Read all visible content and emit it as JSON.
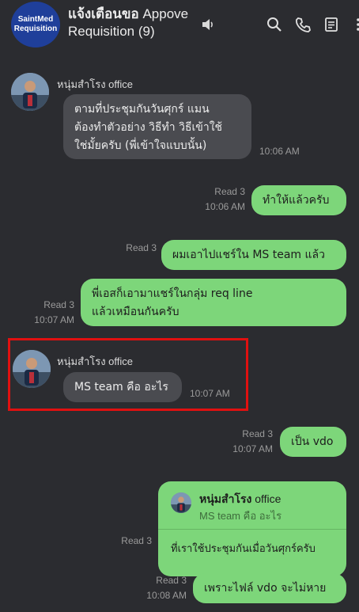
{
  "header": {
    "group_avatar_lines": [
      "SaintMed",
      "Requisition"
    ],
    "title_prefix": "แจ้งเตือนขอ",
    "title_rest": " Appove Requisition (9)",
    "icons": [
      "speaker-icon",
      "search-icon",
      "phone-icon",
      "notes-icon",
      "more-icon"
    ]
  },
  "messages": [
    {
      "sender": "หนุ่มสำโรง office",
      "lines": [
        "ตามที่ประชุมกันวันศุกร์ แมน",
        "ต้องทำตัวอย่าง วิธีทำ วิธีเข้าใช้",
        "ใช่มั้ยครับ (พี่เข้าใจแบบนั้น)"
      ],
      "time": "10:06 AM"
    },
    {
      "read": "Read 3",
      "time": "10:06 AM",
      "text": "ทำให้แล้วครับ"
    },
    {
      "read": "Read 3",
      "text": "ผมเอาไปแชร์ใน MS team แล้ว"
    },
    {
      "read": "Read 3",
      "time": "10:07 AM",
      "lines": [
        "พี่เอสก็เอามาแชร์ในกลุ่ม req line",
        "แล้วเหมือนกันครับ"
      ]
    },
    {
      "sender": "หนุ่มสำโรง office",
      "text": "MS team คือ อะไร",
      "time": "10:07 AM"
    },
    {
      "read": "Read 3",
      "time": "10:07 AM",
      "text": "เป็น vdo"
    },
    {
      "read": "Read 3",
      "reply_name": "หนุ่มสำโรง",
      "reply_name_suffix": " office",
      "reply_quote": "MS team คือ อะไร",
      "text": "ที่เราใช้ประชุมกันเมื่อวันศุกร์ครับ"
    },
    {
      "read": "Read 3",
      "time": "10:08 AM",
      "text": "เพราะไฟล์ vdo จะไม่หาย"
    }
  ],
  "colors": {
    "background": "#2b2c30",
    "incoming": "#4a4b50",
    "outgoing": "#7dd67a",
    "highlight": "#e01010",
    "header_avatar": "#1f3f9a"
  }
}
